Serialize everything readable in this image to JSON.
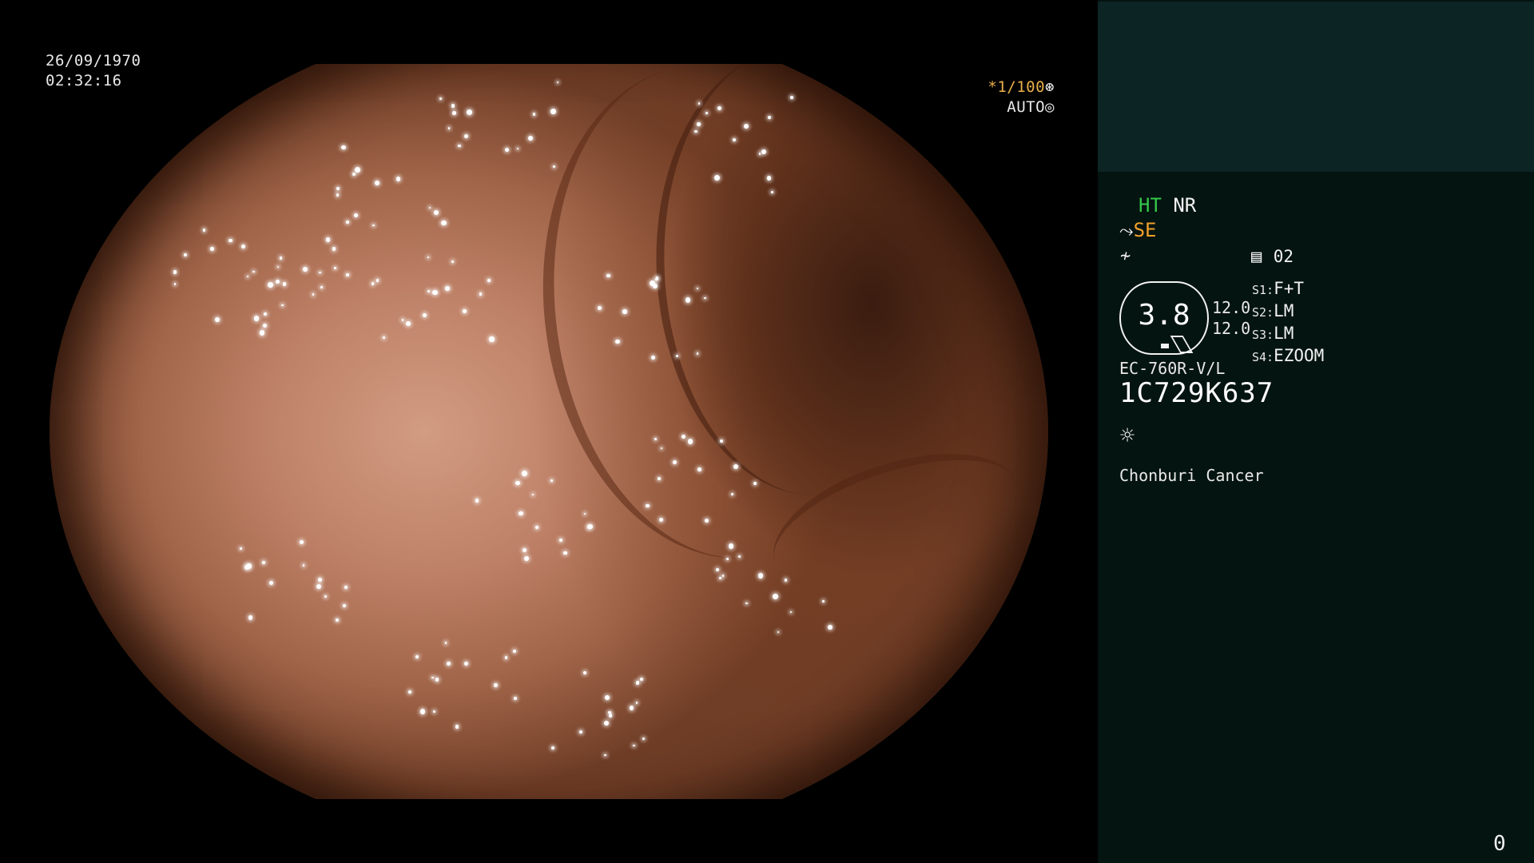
{
  "overlay": {
    "date": "26/09/1970",
    "time": "02:32:16",
    "shutter": "*1/100",
    "exposure_mode": "AUTO"
  },
  "panel": {
    "ht_label": "HT",
    "nr_label": "NR",
    "se_label": "SE",
    "memory_label": "02",
    "zoom_value": "3.8",
    "value_a": "12.0",
    "value_b": "12.0",
    "switches": [
      {
        "key": "S1:",
        "value": "F+T"
      },
      {
        "key": "S2:",
        "value": "LM"
      },
      {
        "key": "S3:",
        "value": "LM"
      },
      {
        "key": "S4:",
        "value": "EZOOM"
      }
    ],
    "scope_model": "EC-760R-V/L",
    "scope_serial": "1C729K637",
    "institution": "Chonburi Cancer",
    "footer_number": "0"
  },
  "colors": {
    "ht": "#35c84a",
    "se": "#f0a02a",
    "shutter": "#e9b04a",
    "panel_bg": "#041410",
    "panel_top_bg": "#0d2424"
  },
  "icons": {
    "shutter_icon": "aperture-icon",
    "exposure_icon": "iris-icon",
    "structure_icon": "structure-enhance-icon",
    "color_icon": "color-mode-icon",
    "memory_icon": "memory-card-icon",
    "light_icon": "light-source-icon"
  }
}
